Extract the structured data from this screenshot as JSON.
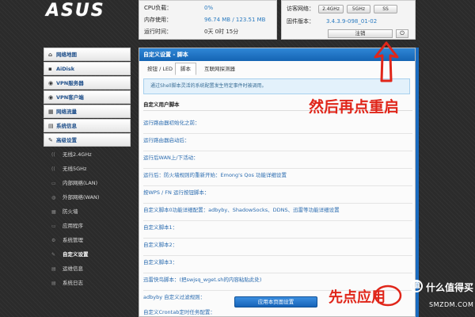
{
  "brand": {
    "logo_text": "ASUS"
  },
  "status_left": [
    {
      "key": "CPU负载：",
      "value": "0%"
    },
    {
      "key": "内存使用：",
      "value": "96.74 MB / 123.51 MB"
    },
    {
      "key": "运行时间：",
      "value": "0天 0时 15分"
    }
  ],
  "status_right": {
    "wireless_label": "访客网络：",
    "band_buttons": [
      "2.4GHz",
      "5GHz",
      "SS"
    ],
    "firmware_label": "固件版本：",
    "firmware_value": "3.4.3.9-098_01-02",
    "logout_label": "注销",
    "power_glyph": "⏻"
  },
  "sidebar": {
    "items": [
      {
        "label": "网络地图",
        "icon": "home-icon",
        "glyph": "⌂"
      },
      {
        "label": "AiDisk",
        "icon": "disk-icon",
        "glyph": "▪"
      },
      {
        "label": "VPN服务器",
        "icon": "vpn-server-icon",
        "glyph": "◉"
      },
      {
        "label": "VPN客户端",
        "icon": "vpn-client-icon",
        "glyph": "◉"
      },
      {
        "label": "网络流量",
        "icon": "traffic-icon",
        "glyph": "▦"
      },
      {
        "label": "系统信息",
        "icon": "info-icon",
        "glyph": "▤"
      },
      {
        "label": "高级设置",
        "icon": "wrench-icon",
        "glyph": "✎"
      }
    ],
    "subitems": [
      {
        "label": "无线2.4GHz",
        "glyph": "(("
      },
      {
        "label": "无线5GHz",
        "glyph": "(("
      },
      {
        "label": "内部网络(LAN)",
        "glyph": "▭"
      },
      {
        "label": "外部网络(WAN)",
        "glyph": "◍"
      },
      {
        "label": "防火墙",
        "glyph": "▦"
      },
      {
        "label": "应用程序",
        "glyph": "▭"
      },
      {
        "label": "系统管理",
        "glyph": "⚙"
      },
      {
        "label": "自定义设置",
        "glyph": "✎",
        "active": true
      },
      {
        "label": "运维信息",
        "glyph": "▤"
      },
      {
        "label": "系统日志",
        "glyph": "▤"
      }
    ]
  },
  "main": {
    "title": "自定义设置 - 脚本",
    "tabs": [
      "按钮 / LED",
      "脚本",
      "互联网探测器"
    ],
    "active_tab": 1,
    "info": "通过Shell脚本灵活的系统配置发生特定事件时被调用。",
    "section_title": "自定义用户脚本",
    "scripts": [
      "运行路由器初始化之前：",
      "运行路由器启动后：",
      "运行后WAN上/下活动：",
      "运行后：防火墙规则的重新开始：Emong's Qos 功能详细设置",
      "按WPS / FN 运行按钮脚本：",
      "自定义脚本0功能详细配置：adbyby、ShadowSocks、DDNS、迅雷等功能详细设置",
      "自定义脚本1：",
      "自定义脚本2：",
      "自定义脚本3：",
      "迅雷快鸟脚本：(把swjsq_wget.sh的内容粘贴此处)",
      "adbyby 自定义过滤规则：",
      "自定义Crontab定时任务配置："
    ],
    "apply_label": "应用本页面设置"
  },
  "annotations": {
    "restart_hint": "然后再点重启",
    "apply_hint": "先点应用",
    "color": "#e0261a"
  },
  "watermark": {
    "icon_glyph": "值",
    "main": "什么值得买",
    "sub": "SMZDM.COM"
  }
}
